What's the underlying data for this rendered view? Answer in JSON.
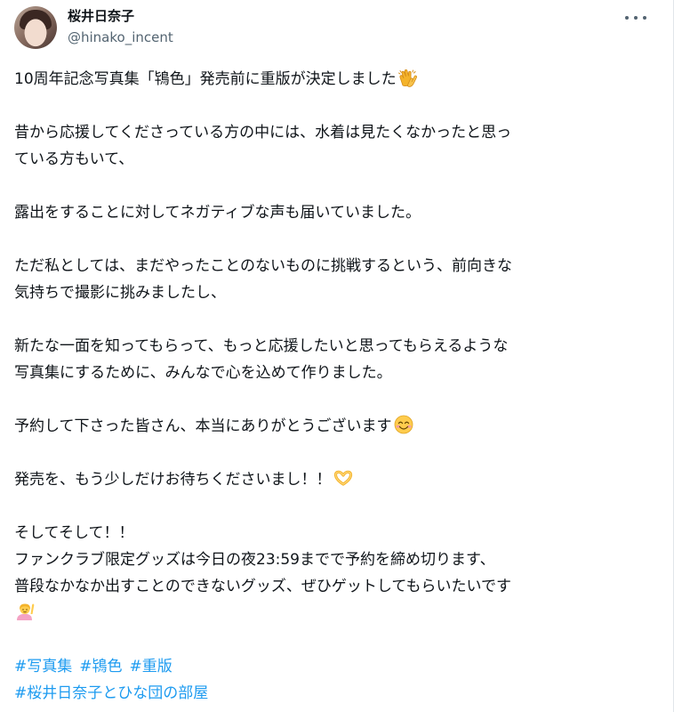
{
  "author": {
    "display_name": "桜井日奈子",
    "handle": "@hinako_incent"
  },
  "post": {
    "lines": [
      "10周年記念写真集「鴇色」発売前に重版が決定しました",
      "昔から応援してくださっている方の中には、水着は見たくなかったと思っ",
      "ている方もいて、",
      "露出をすることに対してネガティブな声も届いていました。",
      "ただ私としては、まだやったことのないものに挑戦するという、前向きな",
      "気持ちで撮影に挑みましたし、",
      "新たな一面を知ってもらって、もっと応援したいと思ってもらえるような",
      "写真集にするために、みんなで心を込めて作りました。",
      "予約して下さった皆さん、本当にありがとうございます",
      "発売を、もう少しだけお待ちくださいまし！！",
      "そしてそして！！",
      "ファンクラブ限定グッズは今日の夜23:59までで予約を締め切ります、",
      "普段なかなか出すことのできないグッズ、ぜひゲットしてもらいたいです"
    ],
    "hashtags": [
      "#写真集",
      "#鴇色",
      "#重版",
      "#桜井日奈子とひな団の部屋"
    ]
  },
  "icons": {
    "clap": "clapping-hands-icon",
    "smile": "smiling-face-icon",
    "heart_hands": "heart-hands-icon",
    "person_raising_hand": "person-raising-hand-icon",
    "more": "more-options-icon"
  },
  "colors": {
    "text": "#0f1419",
    "secondary": "#536471",
    "link": "#1d9bf0"
  }
}
